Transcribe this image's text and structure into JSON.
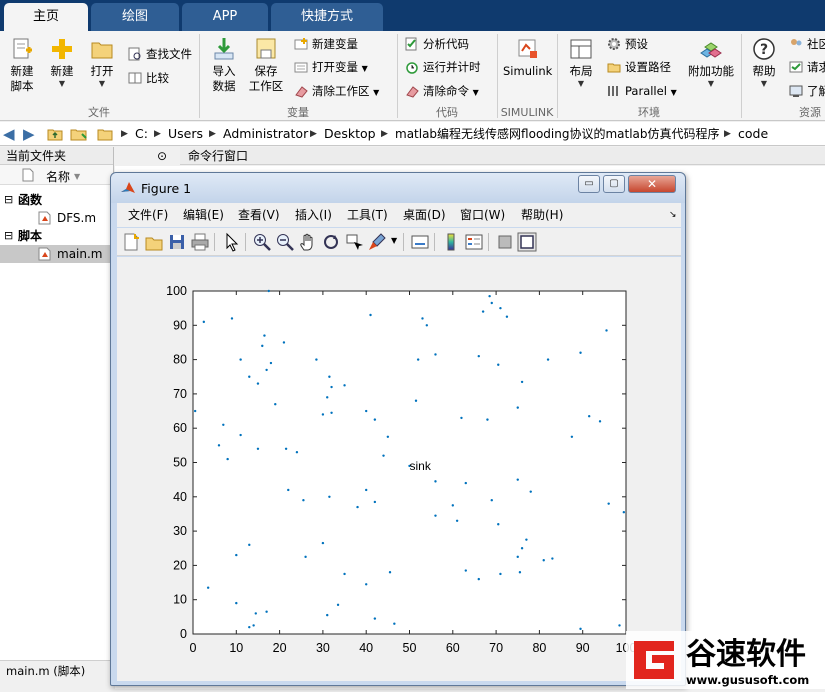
{
  "tabs": [
    {
      "label": "主页",
      "active": true
    },
    {
      "label": "绘图",
      "active": false
    },
    {
      "label": "APP",
      "active": false
    },
    {
      "label": "快捷方式",
      "active": false
    }
  ],
  "ribbon": {
    "file": {
      "new_script": "新建\n脚本",
      "new": "新建",
      "open": "打开",
      "find_files": "查找文件",
      "compare": "比较",
      "label": "文件"
    },
    "variable": {
      "import_data": "导入\n数据",
      "save_workspace": "保存\n工作区",
      "new_variable": "新建变量",
      "open_variable": "打开变量",
      "clear_workspace": "清除工作区",
      "label": "变量"
    },
    "code": {
      "analyze_code": "分析代码",
      "run_and_time": "运行并计时",
      "clear_commands": "清除命令",
      "label": "代码"
    },
    "simulink": {
      "button": "Simulink",
      "label": "SIMULINK"
    },
    "environment": {
      "layout": "布局",
      "preferences": "预设",
      "set_path": "设置路径",
      "parallel": "Parallel",
      "add_ons": "附加功能",
      "label": "环境"
    },
    "resources": {
      "help": "帮助",
      "community": "社区",
      "request_support": "请求",
      "learn": "了解",
      "label": "资源"
    }
  },
  "path": {
    "crumbs": [
      "C:",
      "Users",
      "Administrator",
      "Desktop",
      "matlab编程无线传感网flooding协议的matlab仿真代码程序",
      "code"
    ]
  },
  "left_panel": {
    "title": "当前文件夹",
    "name_col": "名称",
    "groups": [
      {
        "label": "函数",
        "files": [
          "DFS.m"
        ]
      },
      {
        "label": "脚本",
        "files": [
          "main.m"
        ]
      }
    ],
    "status": "main.m  (脚本)"
  },
  "command_window": {
    "title": "命令行窗口"
  },
  "figure": {
    "title": "Figure 1",
    "menu": [
      "文件(F)",
      "编辑(E)",
      "查看(V)",
      "插入(I)",
      "工具(T)",
      "桌面(D)",
      "窗口(W)",
      "帮助(H)"
    ],
    "min_button": "▭",
    "max_button": "▢",
    "close_button": "✕"
  },
  "chart_data": {
    "type": "scatter",
    "title": "",
    "xlabel": "",
    "ylabel": "",
    "xlim": [
      0,
      100
    ],
    "ylim": [
      0,
      100
    ],
    "xticks": [
      0,
      10,
      20,
      30,
      40,
      50,
      60,
      70,
      80,
      90,
      100
    ],
    "yticks": [
      0,
      10,
      20,
      30,
      40,
      50,
      60,
      70,
      80,
      90,
      100
    ],
    "grid": false,
    "marker_color": "#0072bd",
    "annotation": {
      "text": "sink",
      "x": 50,
      "y": 49
    },
    "points": [
      [
        50,
        49
      ],
      [
        2.5,
        91
      ],
      [
        9,
        92
      ],
      [
        11,
        80
      ],
      [
        13,
        75
      ],
      [
        15,
        73
      ],
      [
        17,
        77
      ],
      [
        16,
        84
      ],
      [
        16.5,
        87
      ],
      [
        18,
        79
      ],
      [
        19,
        67
      ],
      [
        17.5,
        100
      ],
      [
        21,
        85
      ],
      [
        0.5,
        65
      ],
      [
        7,
        61
      ],
      [
        11,
        58
      ],
      [
        6,
        55
      ],
      [
        8,
        51
      ],
      [
        15,
        54
      ],
      [
        21.5,
        54
      ],
      [
        24,
        53
      ],
      [
        22,
        42
      ],
      [
        25.5,
        39
      ],
      [
        31.5,
        40
      ],
      [
        3.5,
        13.5
      ],
      [
        10,
        23
      ],
      [
        13,
        26
      ],
      [
        26,
        22.5
      ],
      [
        30,
        26.5
      ],
      [
        28.5,
        80
      ],
      [
        31.5,
        75
      ],
      [
        32,
        72
      ],
      [
        31,
        69
      ],
      [
        30,
        64
      ],
      [
        32,
        64.5
      ],
      [
        35,
        72.5
      ],
      [
        40,
        65
      ],
      [
        42,
        62.5
      ],
      [
        45,
        57.5
      ],
      [
        44,
        52
      ],
      [
        40,
        42
      ],
      [
        42,
        38.5
      ],
      [
        38,
        37
      ],
      [
        41,
        93
      ],
      [
        53,
        92
      ],
      [
        54,
        90
      ],
      [
        52,
        80
      ],
      [
        56,
        81.5
      ],
      [
        51.5,
        68
      ],
      [
        56,
        44.5
      ],
      [
        56,
        34.5
      ],
      [
        63,
        44
      ],
      [
        60,
        37.5
      ],
      [
        61,
        33
      ],
      [
        62,
        63
      ],
      [
        66,
        81
      ],
      [
        68,
        62.5
      ],
      [
        67,
        94
      ],
      [
        68.5,
        98.5
      ],
      [
        69,
        96.5
      ],
      [
        71,
        95
      ],
      [
        72.5,
        92.5
      ],
      [
        70.5,
        78.5
      ],
      [
        75,
        66
      ],
      [
        76,
        73.5
      ],
      [
        78,
        41.5
      ],
      [
        75,
        45
      ],
      [
        69,
        39
      ],
      [
        70.5,
        32
      ],
      [
        77,
        27.5
      ],
      [
        76,
        25
      ],
      [
        75,
        22.5
      ],
      [
        75.5,
        18
      ],
      [
        71,
        17.5
      ],
      [
        66,
        16
      ],
      [
        63,
        18.5
      ],
      [
        82,
        80
      ],
      [
        83,
        22
      ],
      [
        81,
        21.5
      ],
      [
        87.5,
        57.5
      ],
      [
        89.5,
        82
      ],
      [
        91.5,
        63.5
      ],
      [
        94,
        62
      ],
      [
        95.5,
        88.5
      ],
      [
        96,
        38
      ],
      [
        99.5,
        35.5
      ],
      [
        98.5,
        2.5
      ],
      [
        89.5,
        1.5
      ],
      [
        35,
        17.5
      ],
      [
        40,
        14.5
      ],
      [
        45.5,
        18
      ],
      [
        33.5,
        8.5
      ],
      [
        31,
        5.5
      ],
      [
        42,
        4.5
      ],
      [
        46.5,
        3
      ],
      [
        14.5,
        6
      ],
      [
        17,
        6.5
      ],
      [
        10,
        9
      ],
      [
        13,
        2
      ],
      [
        14,
        2.5
      ]
    ]
  },
  "logo": {
    "brand": "谷速软件",
    "url": "www.gususoft.com"
  },
  "colors": {
    "tabbar": "#0f3a6e",
    "figure_frame": "#c9d9ee",
    "accent": "#0072bd",
    "logo_red": "#e2261e"
  }
}
